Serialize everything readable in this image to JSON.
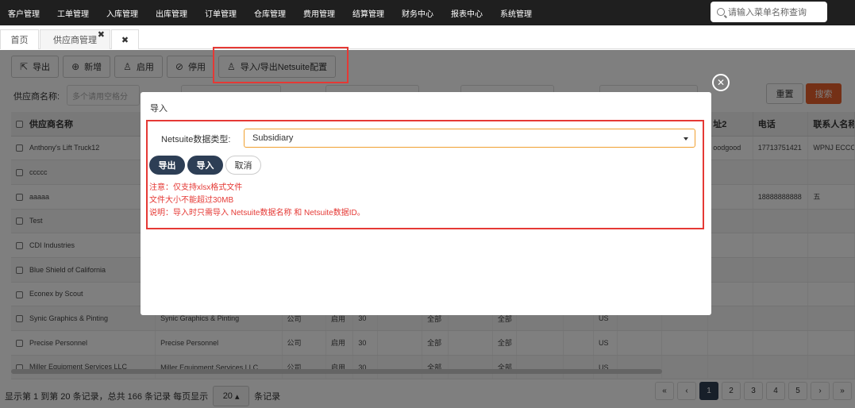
{
  "topnav": {
    "menu": [
      "客户管理",
      "工单管理",
      "入库管理",
      "出库管理",
      "订单管理",
      "仓库管理",
      "费用管理",
      "结算管理",
      "财务中心",
      "报表中心",
      "系统管理"
    ],
    "search_placeholder": "请输入菜单名称查询"
  },
  "tabs": {
    "home": "首页",
    "vendor": "供应商管理",
    "vendor_close": "✖",
    "close_all": "✖"
  },
  "toolbar": {
    "export": "导出",
    "add": "新增",
    "enable": "启用",
    "disable": "停用",
    "netsuite": "导入/导出Netsuite配置"
  },
  "filters": {
    "vendor_name_label": "供应商名称:",
    "vendor_name_placeholder": "多个请用空格分",
    "reset": "重置",
    "search": "搜索"
  },
  "table": {
    "headers": [
      "供应商名称",
      "",
      "",
      "",
      "",
      "",
      "",
      "",
      "",
      "",
      "",
      "",
      "",
      "",
      "址2",
      "电话",
      "联系人名称"
    ],
    "rows": [
      {
        "name": "Anthony's Lift Truck12",
        "name2": "",
        "type": "",
        "status": "",
        "num": "",
        "area": "",
        "area2": "",
        "country": "",
        "addr2": "oodgood",
        "phone": "17713751421",
        "contact": "WPNJ ECCO"
      },
      {
        "name": "ccccc",
        "name2": "",
        "type": "",
        "status": "",
        "num": "",
        "area": "",
        "area2": "",
        "country": "",
        "addr2": "",
        "phone": "",
        "contact": ""
      },
      {
        "name": "aaaaa",
        "name2": "",
        "type": "",
        "status": "",
        "num": "",
        "area": "",
        "area2": "",
        "country": "",
        "addr2": "",
        "phone": "18888888888",
        "contact": "五"
      },
      {
        "name": "Test",
        "name2": "",
        "type": "",
        "status": "",
        "num": "",
        "area": "",
        "area2": "",
        "country": "",
        "addr2": "",
        "phone": "",
        "contact": ""
      },
      {
        "name": "CDI Industries",
        "name2": "",
        "type": "",
        "status": "",
        "num": "",
        "area": "",
        "area2": "",
        "country": "",
        "addr2": "",
        "phone": "",
        "contact": ""
      },
      {
        "name": "Blue Shield of California",
        "name2": "",
        "type": "",
        "status": "",
        "num": "",
        "area": "",
        "area2": "",
        "country": "",
        "addr2": "",
        "phone": "",
        "contact": ""
      },
      {
        "name": "Econex by Scout",
        "name2": "",
        "type": "",
        "status": "",
        "num": "",
        "area": "",
        "area2": "",
        "country": "",
        "addr2": "",
        "phone": "",
        "contact": ""
      },
      {
        "name": "Synic Graphics & Pinting",
        "name2": "Synic Graphics & Pinting",
        "type": "公司",
        "status": "启用",
        "num": "30",
        "area": "全部",
        "area2": "全部",
        "country": "US",
        "addr2": "",
        "phone": "",
        "contact": ""
      },
      {
        "name": "Precise Personnel",
        "name2": "Precise Personnel",
        "type": "公司",
        "status": "启用",
        "num": "30",
        "area": "全部",
        "area2": "全部",
        "country": "US",
        "addr2": "",
        "phone": "",
        "contact": ""
      },
      {
        "name": "Miller Equipment Services LLC",
        "name2": "Miller Equipment Services LLC",
        "type": "公司",
        "status": "启用",
        "num": "30",
        "area": "全部",
        "area2": "全部",
        "country": "US",
        "addr2": "",
        "phone": "",
        "contact": ""
      }
    ]
  },
  "footer": {
    "summary_prefix": "显示第 1 到第 20 条记录，总共 166 条记录 每页显示",
    "page_size": "20",
    "summary_suffix": "条记录"
  },
  "pager": [
    "«",
    "‹",
    "1",
    "2",
    "3",
    "4",
    "5",
    "›",
    "»"
  ],
  "modal": {
    "title": "导入",
    "close_icon": "⊗",
    "type_label": "Netsuite数据类型:",
    "type_value": "Subsidiary",
    "btn_export": "导出",
    "btn_import": "导入",
    "btn_cancel": "取消",
    "notes": [
      "注意：仅支持xlsx格式文件",
      "文件大小不能超过30MB",
      "说明：导入时只需导入 Netsuite数据名称 和 Netsuite数据ID。"
    ]
  }
}
